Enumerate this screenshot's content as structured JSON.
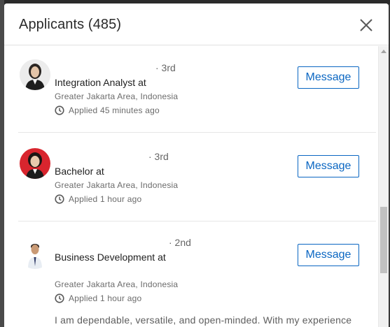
{
  "modal": {
    "title": "Applicants (485)"
  },
  "applicants": [
    {
      "degree": "· 3rd",
      "headline": "Integration Analyst at",
      "location": "Greater Jakarta Area, Indonesia",
      "applied": "Applied 45 minutes ago",
      "message_label": "Message"
    },
    {
      "degree": "· 3rd",
      "headline": "Bachelor at",
      "location": "Greater Jakarta Area, Indonesia",
      "applied": "Applied 1 hour ago",
      "message_label": "Message"
    },
    {
      "degree": "· 2nd",
      "headline": "Business Development at",
      "location": "Greater Jakarta Area, Indonesia",
      "applied": "Applied 1 hour ago",
      "message_label": "Message",
      "summary": "I am dependable, versatile, and open-minded. With my experience"
    }
  ],
  "colors": {
    "accent": "#0a66c2",
    "avatar2_bg": "#d8252e"
  },
  "icons": [
    "close-icon",
    "clock-icon"
  ]
}
